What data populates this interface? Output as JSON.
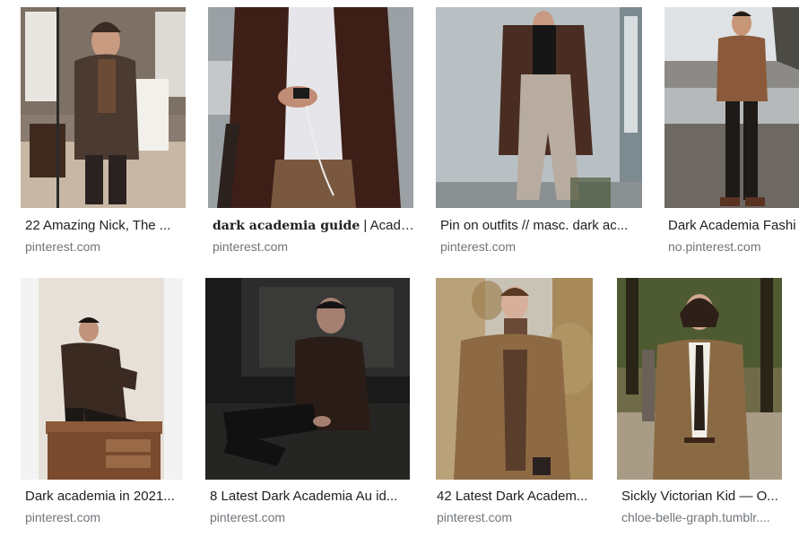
{
  "results": [
    {
      "title": "22 Amazing Nick, The ...",
      "title_bold": "",
      "title_rest": "",
      "source": "pinterest.com"
    },
    {
      "title": "",
      "title_bold": "dark academia guide",
      "title_rest": " | Acade...",
      "source": "pinterest.com"
    },
    {
      "title": "Pin on outfits // masc. dark ac...",
      "title_bold": "",
      "title_rest": "",
      "source": "pinterest.com"
    },
    {
      "title": "Dark Academia Fashi",
      "title_bold": "",
      "title_rest": "",
      "source": "no.pinterest.com"
    },
    {
      "title": "Dark academia in 2021...",
      "title_bold": "",
      "title_rest": "",
      "source": "pinterest.com"
    },
    {
      "title": "8 Latest Dark Academia Au id...",
      "title_bold": "",
      "title_rest": "",
      "source": "pinterest.com"
    },
    {
      "title": "42 Latest Dark Academ...",
      "title_bold": "",
      "title_rest": "",
      "source": "pinterest.com"
    },
    {
      "title": "Sickly Victorian Kid — O...",
      "title_bold": "",
      "title_rest": "",
      "source": "chloe-belle-graph.tumblr...."
    }
  ]
}
